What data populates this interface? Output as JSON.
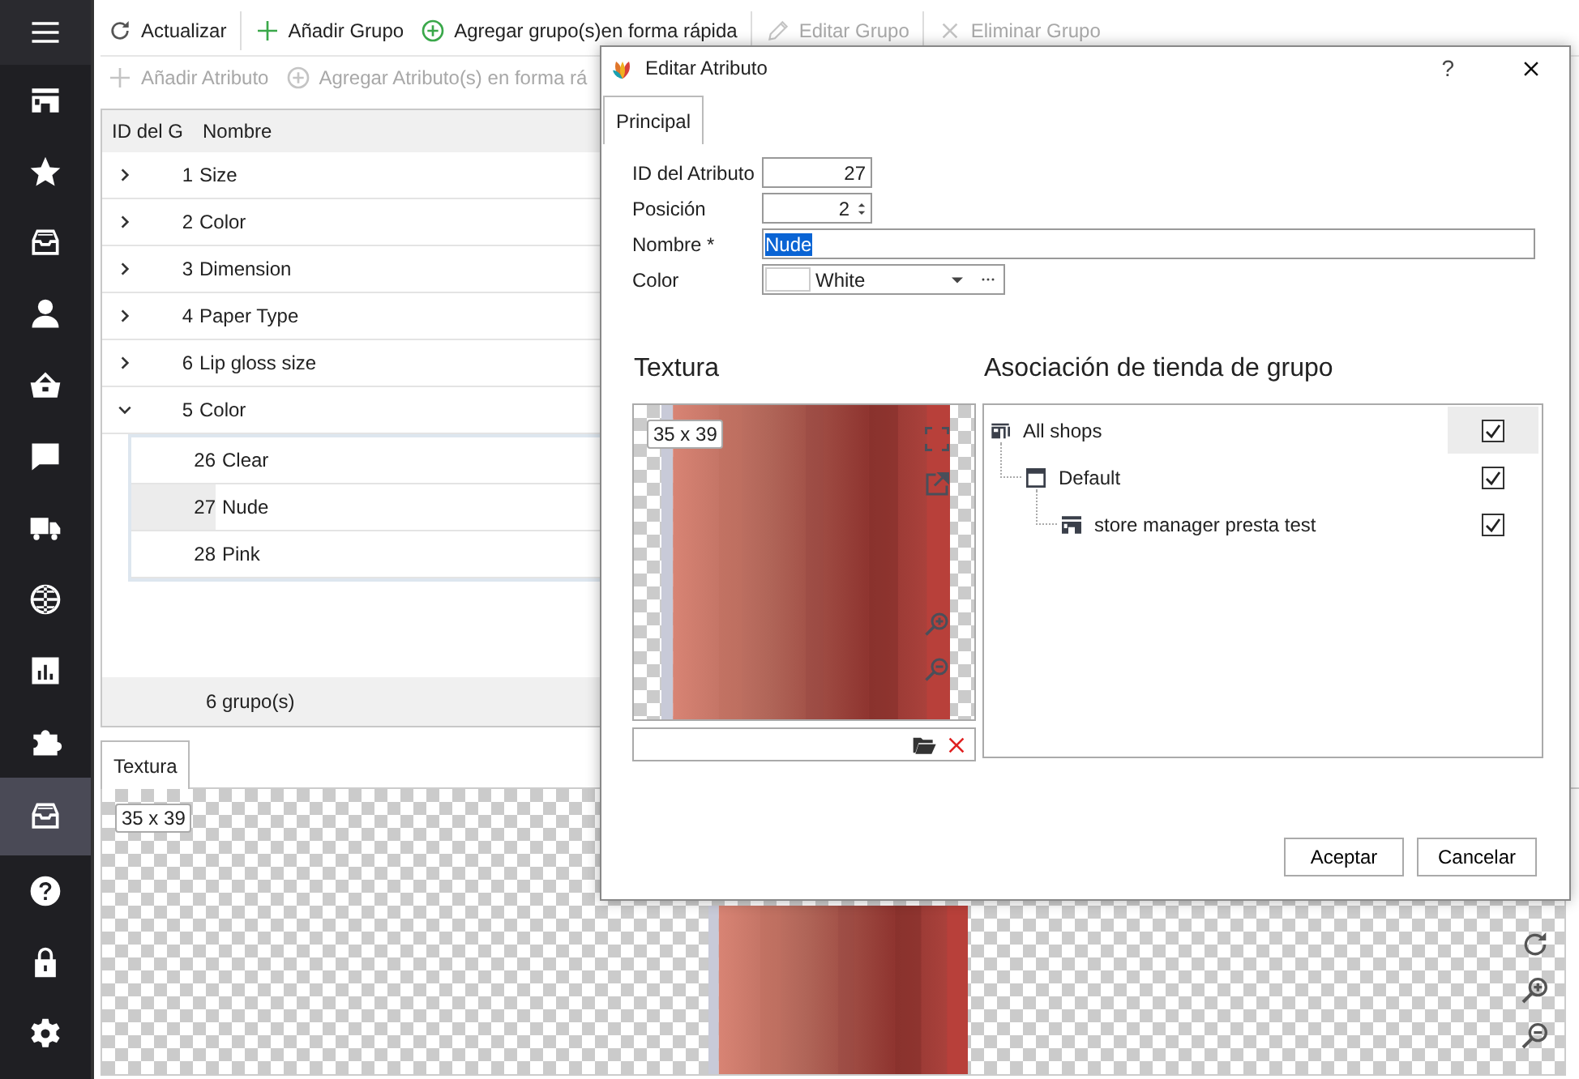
{
  "sidebar": {
    "items": [
      {
        "kind": "menu",
        "selected": false
      },
      {
        "kind": "store",
        "selected": false
      },
      {
        "kind": "star",
        "selected": false
      },
      {
        "kind": "inbox",
        "selected": false
      },
      {
        "kind": "user",
        "selected": false
      },
      {
        "kind": "basket",
        "selected": false
      },
      {
        "kind": "chat",
        "selected": false
      },
      {
        "kind": "truck",
        "selected": false
      },
      {
        "kind": "globe",
        "selected": false
      },
      {
        "kind": "chart",
        "selected": false
      },
      {
        "kind": "puzzle",
        "selected": false
      },
      {
        "kind": "inbox",
        "selected": true
      },
      {
        "kind": "help",
        "selected": false
      },
      {
        "kind": "lock",
        "selected": false
      },
      {
        "kind": "settings",
        "selected": false
      }
    ]
  },
  "toolbar": [
    {
      "kind": "refresh",
      "label": "Actualizar",
      "disabled": false
    },
    {
      "kind": "add",
      "label": "Añadir Grupo",
      "disabled": false
    },
    {
      "kind": "add-circle",
      "label": "Agregar grupo(s)en forma rápida",
      "disabled": false
    },
    {
      "kind": "edit",
      "label": "Editar Grupo",
      "disabled": true
    },
    {
      "kind": "delete",
      "label": "Eliminar Grupo",
      "disabled": true
    }
  ],
  "toolbar_2": [
    {
      "kind": "add",
      "label": "Añadir Atributo",
      "disabled": true
    },
    {
      "kind": "add-circle",
      "label": "Agregar Atributo(s) en forma rá",
      "disabled": true
    }
  ],
  "grid": {
    "columns": [
      "ID del G",
      "Nombre"
    ],
    "rows": [
      {
        "id": "1",
        "name": "Size",
        "expanded": false
      },
      {
        "id": "2",
        "name": "Color",
        "expanded": false
      },
      {
        "id": "3",
        "name": "Dimension",
        "expanded": false
      },
      {
        "id": "4",
        "name": "Paper Type",
        "expanded": false
      },
      {
        "id": "6",
        "name": "Lip gloss size",
        "expanded": false
      },
      {
        "id": "5",
        "name": "Color",
        "expanded": true,
        "children": [
          {
            "id": "26",
            "name": "Clear",
            "selected": false
          },
          {
            "id": "27",
            "name": "Nude",
            "selected": true
          },
          {
            "id": "28",
            "name": "Pink",
            "selected": false
          }
        ]
      }
    ],
    "footer": "6 grupo(s)"
  },
  "bottom_tabs": [
    {
      "label": "Textura",
      "selected": true
    }
  ],
  "texture_panel": {
    "size": "35 x 39"
  },
  "dialog": {
    "title": "Editar Atributo",
    "help": "?",
    "tabs": [
      {
        "label": "Principal",
        "selected": true
      }
    ],
    "fields": [
      {
        "kind": "number",
        "label": "ID del Atributo",
        "value": "27"
      },
      {
        "kind": "spin",
        "label": "Posición",
        "value": "2"
      },
      {
        "kind": "text",
        "label": "Nombre *",
        "value": "Nude",
        "selected": true
      },
      {
        "kind": "color",
        "label": "Color",
        "value": "White"
      }
    ],
    "texture": {
      "heading": "Textura",
      "size": "35 x 39"
    },
    "shops": {
      "heading": "Asociación de tienda de grupo",
      "tree": [
        {
          "kind": "all",
          "label": "All shops",
          "checked": true,
          "selected": true,
          "children": [
            {
              "kind": "group",
              "label": "Default",
              "checked": true,
              "selected": false,
              "children": [
                {
                  "kind": "shop",
                  "label": "store manager presta test",
                  "checked": true,
                  "selected": false
                }
              ]
            }
          ]
        }
      ]
    },
    "buttons": [
      {
        "label": "Aceptar"
      },
      {
        "label": "Cancelar"
      }
    ]
  }
}
